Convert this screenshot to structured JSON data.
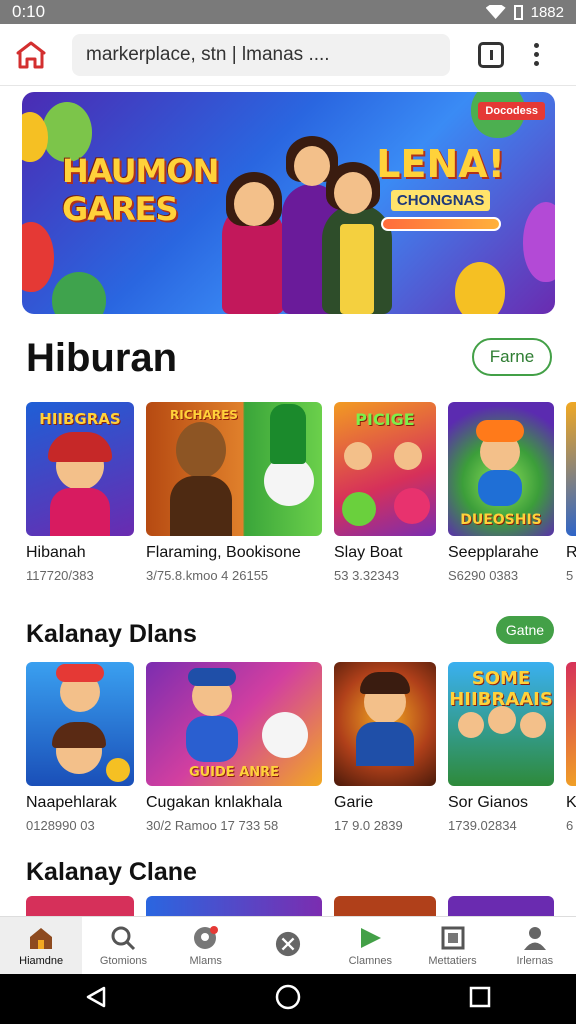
{
  "status_bar": {
    "time": "0:10",
    "battery_text": "1882"
  },
  "browser": {
    "address": "markerplace, stn | lmanas ....",
    "brand_icon": "home-castle-icon",
    "tabs_icon": "tabs-icon",
    "menu_icon": "more-vert-icon"
  },
  "banner": {
    "title_left": [
      "HAUMON",
      "GARES"
    ],
    "title_right": "LENA!",
    "subtitle_right": "CHONGNAS",
    "badge": "Docodess"
  },
  "section1": {
    "title": "Hiburan",
    "pill": "Farne",
    "cards": [
      {
        "thumb_label": "HIIBGRAS",
        "title": "Hibanah",
        "sub": "117720/383"
      },
      {
        "thumb_label": "RICHARES",
        "title": "Flaraming, Bookisone",
        "sub": "3/75.8.kmoo 4 26155"
      },
      {
        "thumb_label": "PICIGE",
        "title": "Slay Boat",
        "sub": "53 3.32343"
      },
      {
        "thumb_label": "DUEOSHIS",
        "title": "Seepplarahe",
        "sub": "S6290 0383"
      },
      {
        "thumb_label": "",
        "title": "R",
        "sub": "5"
      }
    ]
  },
  "section2": {
    "title": "Kalanay Dlans",
    "pill": "Gatne",
    "cards": [
      {
        "thumb_label": "",
        "title": "Naapehlarak",
        "sub": "0128990 03"
      },
      {
        "thumb_label": "GUIDE ANRE",
        "title": "Cugakan knlakhala",
        "sub": "30/2 Ramoo 17 733 58"
      },
      {
        "thumb_label": "",
        "title": "Garie",
        "sub": "17 9.0 2839"
      },
      {
        "thumb_label": "SOME HIIBRAAIS",
        "title": "Sor Gianos",
        "sub": "1739.02834"
      },
      {
        "thumb_label": "",
        "title": "K",
        "sub": "6"
      }
    ]
  },
  "section3": {
    "title": "Kalanay Clane"
  },
  "bottom_nav": [
    {
      "label": "Hiamdne",
      "icon": "home-icon",
      "active": true
    },
    {
      "label": "Gtomions",
      "icon": "search-icon",
      "active": false
    },
    {
      "label": "Mlams",
      "icon": "location-icon",
      "active": false
    },
    {
      "label": "",
      "icon": "compass-icon",
      "active": false
    },
    {
      "label": "Clamnes",
      "icon": "play-icon",
      "active": false
    },
    {
      "label": "Mettatiers",
      "icon": "tablet-icon",
      "active": false
    },
    {
      "label": "Irlernas",
      "icon": "profile-icon",
      "active": false
    }
  ],
  "colors": {
    "accent_green": "#43a047",
    "brand_red": "#d32f2f"
  }
}
